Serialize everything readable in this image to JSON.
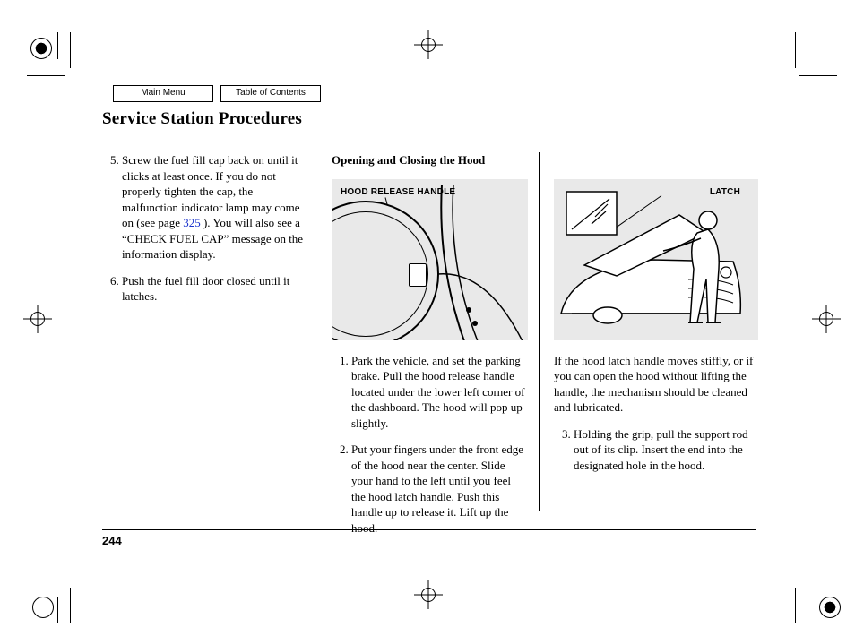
{
  "nav": {
    "main_menu": "Main Menu",
    "toc": "Table of Contents"
  },
  "title": "Service Station Procedures",
  "col1": {
    "step5_pre": "Screw the fuel fill cap back on until it clicks at least once. If you do not properly tighten the cap, the malfunction indicator lamp may come on (see page ",
    "step5_link": "325",
    "step5_post": " ). You will also see a “CHECK FUEL CAP” message on the information display.",
    "step6": "Push the fuel fill door closed until it latches."
  },
  "col2": {
    "heading": "Opening and Closing the Hood",
    "fig_label": "HOOD RELEASE HANDLE",
    "step1": "Park the vehicle, and set the parking brake. Pull the hood release handle located under the lower left corner of the dashboard. The hood will pop up slightly.",
    "step2": "Put your fingers under the front edge of the hood near the center. Slide your hand to the left until you feel the hood latch handle. Push this handle up to release it. Lift up the hood."
  },
  "col3": {
    "fig_label": "LATCH",
    "note": "If the hood latch handle moves stiffly, or if you can open the hood without lifting the handle, the mechanism should be cleaned and lubricated.",
    "step3": "Holding the grip, pull the support rod out of its clip. Insert the end into the designated hole in the hood."
  },
  "page_number": "244"
}
